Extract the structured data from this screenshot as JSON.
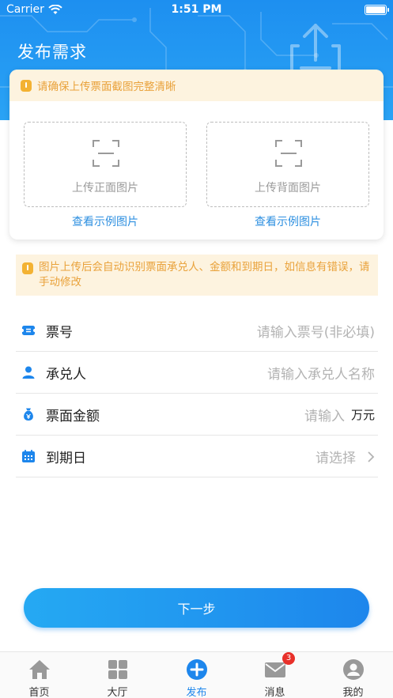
{
  "status_bar": {
    "carrier": "Carrier",
    "time": "1:51 PM"
  },
  "page": {
    "title": "发布需求"
  },
  "upload_card": {
    "tip": "请确保上传票面截图完整清晰",
    "front": {
      "label": "上传正面图片",
      "example_link": "查看示例图片"
    },
    "back": {
      "label": "上传背面图片",
      "example_link": "查看示例图片"
    }
  },
  "ocr_tip": "图片上传后会自动识别票面承兑人、金额和到期日，如信息有错误，请手动修改",
  "form": {
    "bill_number": {
      "icon": "ticket-icon",
      "label": "票号",
      "placeholder": "请输入票号(非必填)"
    },
    "acceptor": {
      "icon": "person-icon",
      "label": "承兑人",
      "placeholder": "请输入承兑人名称"
    },
    "amount": {
      "icon": "money-bag-icon",
      "label": "票面金额",
      "placeholder": "请输入",
      "unit": "万元"
    },
    "due_date": {
      "icon": "calendar-icon",
      "label": "到期日",
      "placeholder": "请选择"
    }
  },
  "next_button": "下一步",
  "tabbar": {
    "items": [
      {
        "label": "首页",
        "icon": "home-icon",
        "active": false
      },
      {
        "label": "大厅",
        "icon": "grid-icon",
        "active": false
      },
      {
        "label": "发布",
        "icon": "plus-circle-icon",
        "active": true
      },
      {
        "label": "消息",
        "icon": "mail-icon",
        "active": false,
        "badge": "3"
      },
      {
        "label": "我的",
        "icon": "user-icon",
        "active": false
      }
    ]
  },
  "colors": {
    "primary": "#1d86ec",
    "header": "#1d8ff0",
    "tip_bg": "#fdf3df",
    "tip_text": "#e9a23b",
    "badge": "#e8302a"
  }
}
